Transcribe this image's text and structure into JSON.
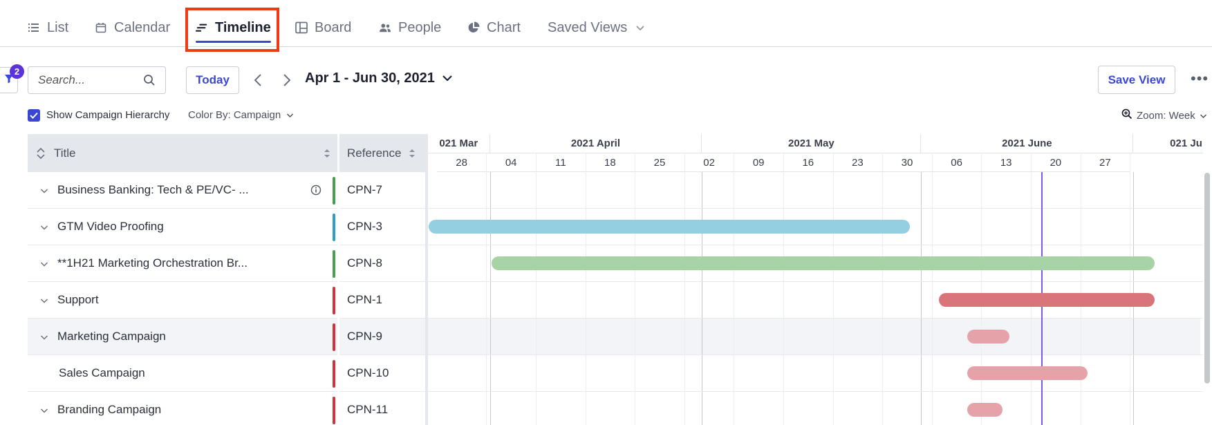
{
  "tabs": [
    {
      "label": "List",
      "icon": "list-icon"
    },
    {
      "label": "Calendar",
      "icon": "calendar-icon"
    },
    {
      "label": "Timeline",
      "icon": "timeline-icon",
      "active": true
    },
    {
      "label": "Board",
      "icon": "board-icon"
    },
    {
      "label": "People",
      "icon": "people-icon"
    },
    {
      "label": "Chart",
      "icon": "pie-chart-icon"
    },
    {
      "label": "Saved Views",
      "icon": "chevron-down-icon"
    }
  ],
  "toolbar": {
    "filter_count": "2",
    "search_placeholder": "Search...",
    "today_label": "Today",
    "date_range": "Apr 1 - Jun 30, 2021",
    "save_view_label": "Save View",
    "more_label": "•••"
  },
  "options": {
    "show_hierarchy_label": "Show Campaign Hierarchy",
    "show_hierarchy_checked": true,
    "color_by_label": "Color By: Campaign",
    "zoom_label": "Zoom: Week"
  },
  "columns": {
    "title": "Title",
    "reference": "Reference"
  },
  "timeline": {
    "months": [
      "021 Mar",
      "2021 April",
      "2021 May",
      "2021 June",
      "021 Ju"
    ],
    "weeks": [
      "28",
      "04",
      "11",
      "18",
      "25",
      "02",
      "09",
      "16",
      "23",
      "30",
      "06",
      "13",
      "20",
      "27"
    ],
    "today_marker_color": "#7a5ae6"
  },
  "rows": [
    {
      "title": "Business Banking: Tech & PE/VC- ...",
      "ref": "CPN-7",
      "color": "#4a9e4f",
      "expandable": true,
      "info": true
    },
    {
      "title": "GTM Video Proofing",
      "ref": "CPN-3",
      "color": "#2ea0c4",
      "expandable": true,
      "bar_color": "#93cfe0"
    },
    {
      "title": "**1H21 Marketing Orchestration Br...",
      "ref": "CPN-8",
      "color": "#4a9e4f",
      "expandable": true,
      "bar_color": "#a8d3a6"
    },
    {
      "title": "Support",
      "ref": "CPN-1",
      "color": "#d0343a",
      "expandable": true,
      "bar_color": "#d9747a"
    },
    {
      "title": "Marketing Campaign",
      "ref": "CPN-9",
      "color": "#d0343a",
      "expandable": true,
      "selected": true,
      "bar_color": "#e5a2a8"
    },
    {
      "title": "Sales Campaign",
      "ref": "CPN-10",
      "color": "#d0343a",
      "expandable": false,
      "bar_color": "#e5a2a8"
    },
    {
      "title": "Branding Campaign",
      "ref": "CPN-11",
      "color": "#d0343a",
      "expandable": true,
      "bar_color": "#e5a2a8"
    }
  ]
}
